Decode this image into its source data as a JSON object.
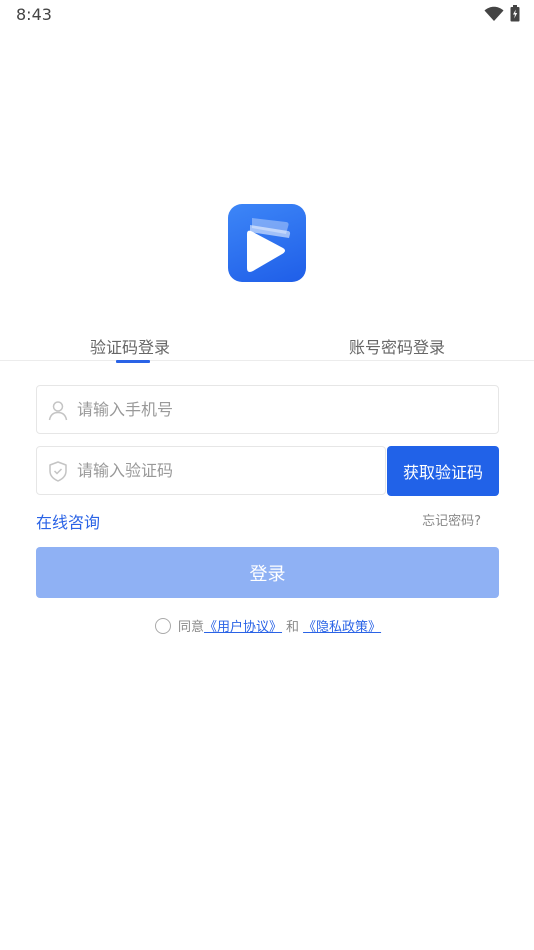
{
  "status_bar": {
    "time": "8:43"
  },
  "tabs": [
    {
      "label": "验证码登录",
      "active": true
    },
    {
      "label": "账号密码登录",
      "active": false
    }
  ],
  "form": {
    "phone_placeholder": "请输入手机号",
    "phone_value": "",
    "code_placeholder": "请输入验证码",
    "code_value": "",
    "get_code_label": "获取验证码",
    "online_consult": "在线咨询",
    "forgot_password": "忘记密码?",
    "login_label": "登录"
  },
  "agreement": {
    "agree_text": "同意",
    "user_agreement": "《用户协议》",
    "and_text": "和",
    "privacy_policy": "《隐私政策》",
    "checked": false
  },
  "colors": {
    "accent": "#2162e8",
    "login_disabled": "#8fb1f4",
    "link": "#2a63e6"
  },
  "icons": {
    "logo": "play-logo-icon",
    "phone_field": "user-icon",
    "code_field": "shield-icon"
  }
}
